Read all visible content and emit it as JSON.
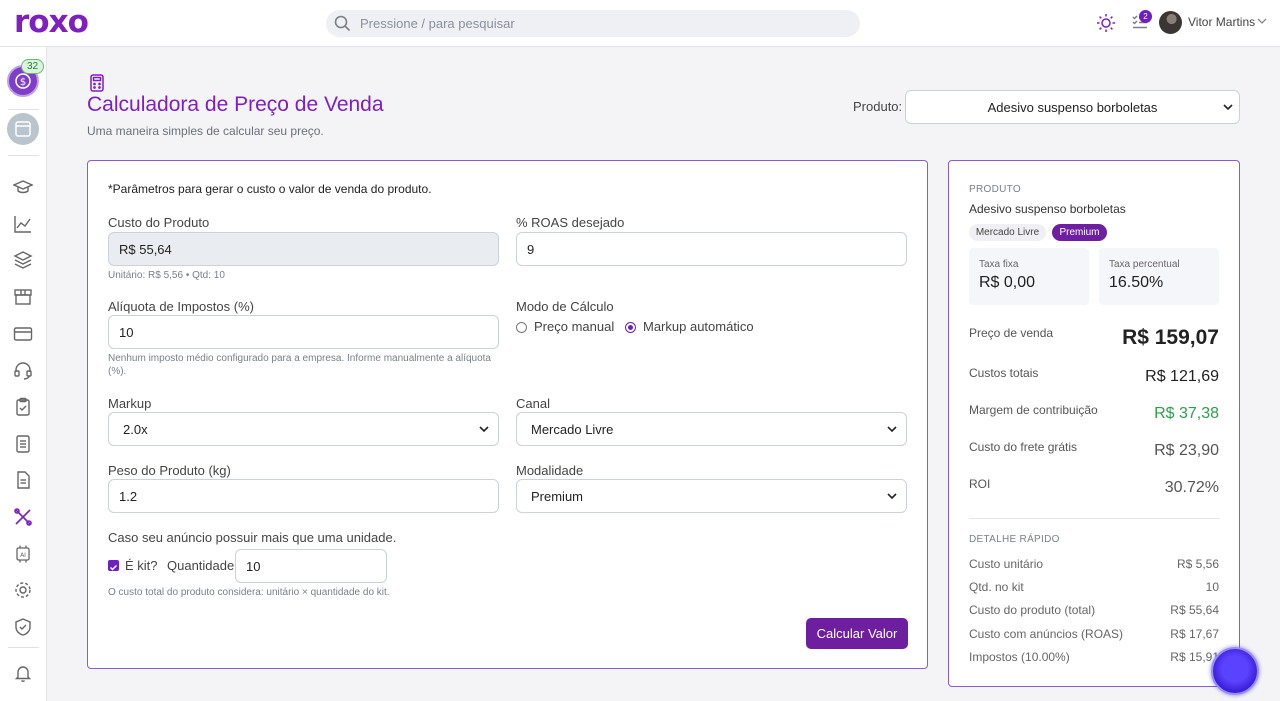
{
  "header": {
    "logo": "roxo",
    "search_placeholder": "Pressione / para pesquisar",
    "tasks_badge": "2",
    "user_name": "Vitor Martins"
  },
  "sidebar": {
    "badge": "32",
    "icons": [
      "graduation-cap-icon",
      "chart-line-icon",
      "layers-icon",
      "storefront-icon",
      "credit-card-icon",
      "headset-icon",
      "clipboard-check-icon",
      "receipt-icon",
      "document-icon",
      "tools-icon",
      "ai-chip-icon",
      "gear-icon",
      "shield-check-icon",
      "bell-icon"
    ]
  },
  "page": {
    "title": "Calculadora de Preço de Venda",
    "subtitle": "Uma maneira simples de calcular seu preço.",
    "product_label": "Produto:",
    "product_selected": "Adesivo suspenso borboletas"
  },
  "form": {
    "intro": "*Parâmetros para gerar o custo o valor de venda do produto.",
    "custo_label": "Custo do Produto",
    "custo_value": "R$ 55,64",
    "custo_hint": "Unitário: R$ 5,56 • Qtd: 10",
    "roas_label": "% ROAS desejado",
    "roas_value": "9",
    "aliquota_label": "Alíquota de Impostos (%)",
    "aliquota_value": "10",
    "aliquota_hint": "Nenhum imposto médio configurado para a empresa. Informe manualmente a alíquota (%).",
    "modo_label": "Modo de Cálculo",
    "modo_manual": "Preço manual",
    "modo_auto": "Markup automático",
    "markup_label": "Markup",
    "markup_value": "2.0x",
    "canal_label": "Canal",
    "canal_value": "Mercado Livre",
    "peso_label": "Peso do Produto (kg)",
    "peso_value": "1.2",
    "modalidade_label": "Modalidade",
    "modalidade_value": "Premium",
    "kit_text": "Caso seu anúncio possuir mais que uma unidade.",
    "kit_check": "É kit?",
    "quantidade_label": "Quantidade",
    "quantidade_value": "10",
    "kit_hint": "O custo total do produto considera: unitário × quantidade do kit.",
    "submit": "Calcular Valor"
  },
  "summary": {
    "caption": "PRODUTO",
    "product_name": "Adesivo suspenso borboletas",
    "chip_channel": "Mercado Livre",
    "chip_mode": "Premium",
    "taxa_fixa_label": "Taxa fixa",
    "taxa_fixa_value": "R$ 0,00",
    "taxa_pct_label": "Taxa percentual",
    "taxa_pct_value": "16.50%",
    "preco_label": "Preço de venda",
    "preco_value": "R$ 159,07",
    "custos_label": "Custos totais",
    "custos_value": "R$ 121,69",
    "margem_label": "Margem de contribuição",
    "margem_value": "R$ 37,38",
    "frete_label": "Custo do frete grátis",
    "frete_value": "R$ 23,90",
    "roi_label": "ROI",
    "roi_value": "30.72%",
    "detail_caption": "DETALHE RÁPIDO",
    "details": [
      {
        "label": "Custo unitário",
        "value": "R$ 5,56"
      },
      {
        "label": "Qtd. no kit",
        "value": "10"
      },
      {
        "label": "Custo do produto (total)",
        "value": "R$ 55,64"
      },
      {
        "label": "Custo com anúncios (ROAS)",
        "value": "R$ 17,67"
      },
      {
        "label": "Impostos (10.00%)",
        "value": "R$ 15,91"
      }
    ]
  },
  "colors": {
    "brand": "#7e1fbf",
    "primary_button": "#6e1f9f",
    "positive": "#2e9e4f"
  }
}
